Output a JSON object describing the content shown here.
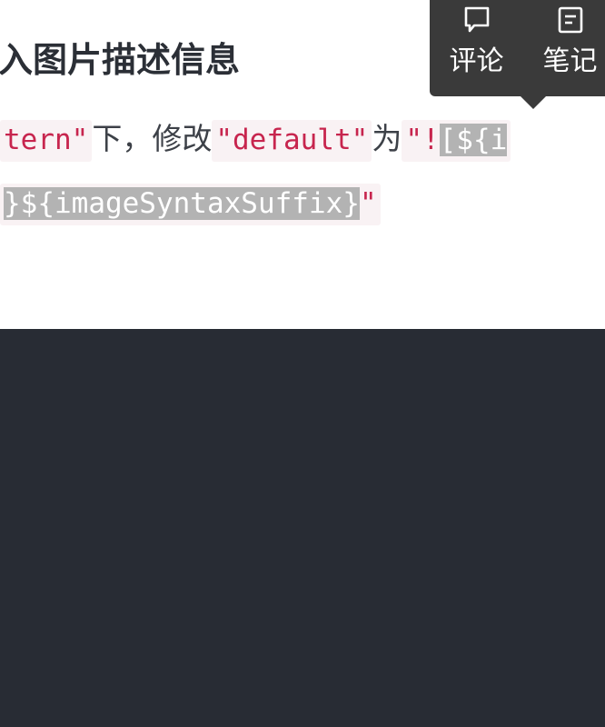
{
  "article": {
    "heading": "入图片描述信息",
    "line1": {
      "code1": "tern\"",
      "text1": "下，修改",
      "code2": "\"default\"",
      "text2": "为",
      "code3_unselected": "\"!",
      "code3_selected": "[${i"
    },
    "line2": {
      "code_selected": "}${imageSyntaxSuffix}",
      "code_unselected": "\""
    }
  },
  "toolbar": {
    "items": [
      {
        "label": "评论",
        "icon": "comment-icon"
      },
      {
        "label": "笔记",
        "icon": "note-icon"
      }
    ]
  },
  "colors": {
    "code_text": "#c7254e",
    "code_bg": "#f9f2f4",
    "selection": "#b3b3b3",
    "toolbar_bg": "#3a3a3a",
    "dark_panel": "#282c34"
  }
}
